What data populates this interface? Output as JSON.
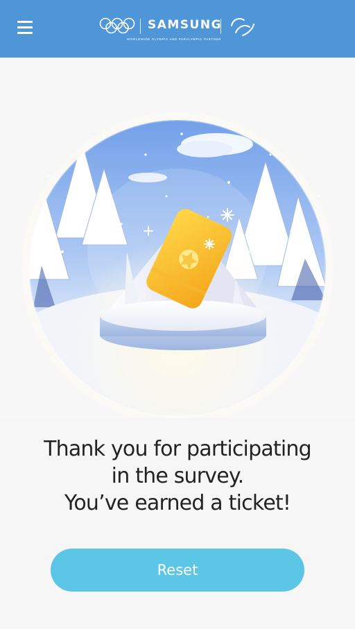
{
  "header": {
    "menu_icon": "hamburger-menu-icon",
    "brand_name": "SAMSUNG",
    "partner_text": "WORLDWIDE OLYMPIC AND PARALYMPIC PARTNER",
    "background_color": "#4f96d8",
    "olympic_logo": "olympic-rings-icon",
    "paralympic_logo": "paralympic-agitos-icon"
  },
  "hero": {
    "illustration": "snow-globe-with-golden-ticket",
    "ticket_icon": "golden-ticket-icon"
  },
  "message": {
    "line1": "Thank you for participating",
    "line2": "in the survey.",
    "line3": "You’ve earned a ticket!"
  },
  "reset_button": {
    "label": "Reset",
    "color": "#5cc6e6"
  }
}
